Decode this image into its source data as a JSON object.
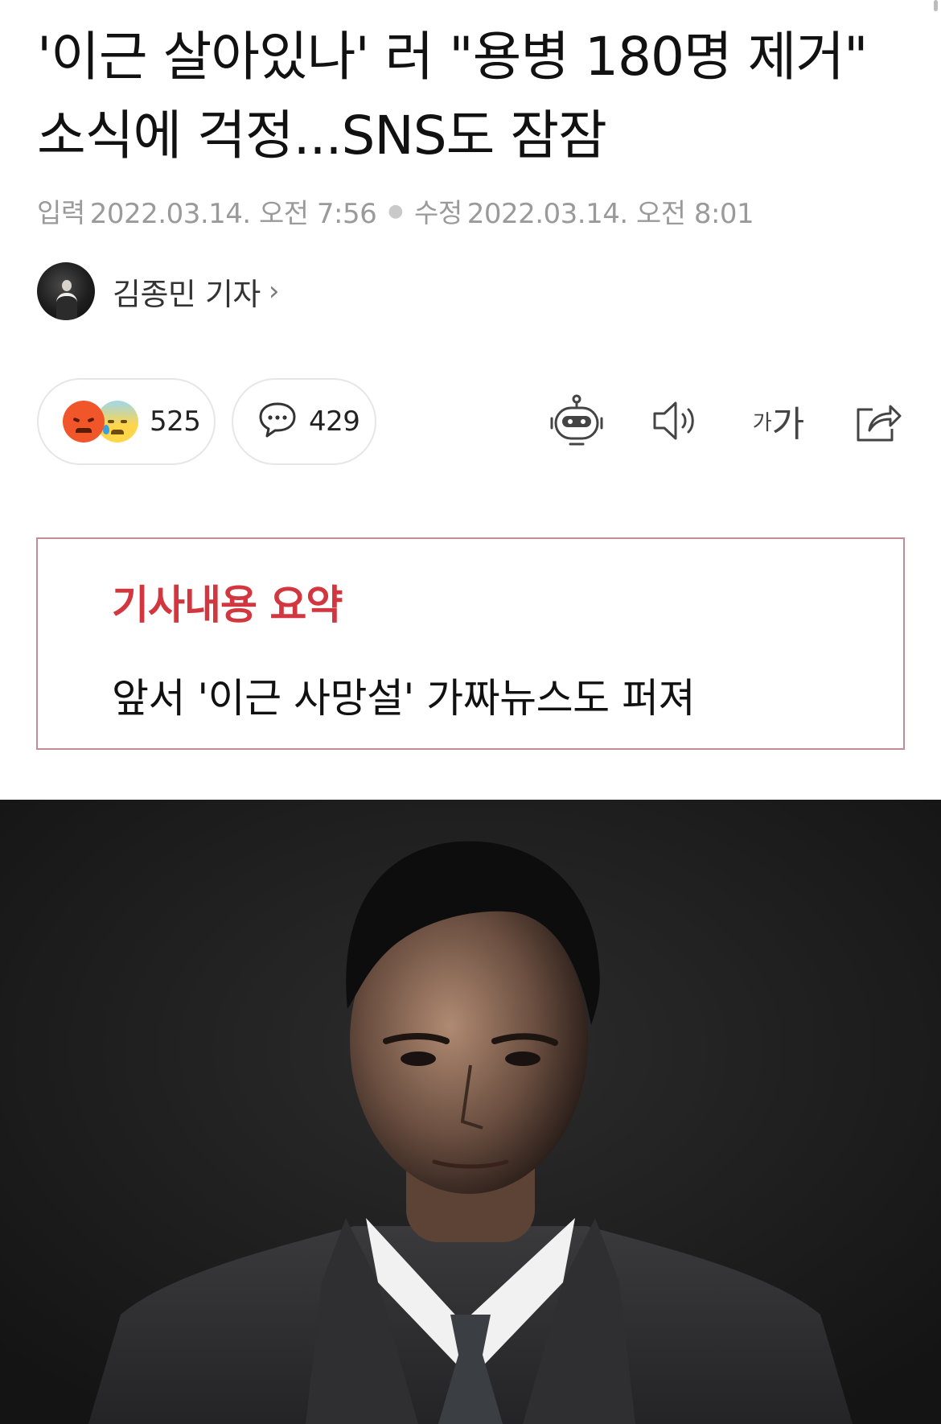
{
  "article": {
    "title": "'이근 살아있나' 러 \"용병 180명 제거\" 소식에 걱정...SNS도 잠잠",
    "input_label": "입력",
    "input_date": "2022.03.14. 오전 7:56",
    "modified_label": "수정",
    "modified_date": "2022.03.14. 오전 8:01",
    "author": "김종민 기자"
  },
  "reactions": {
    "count": "525",
    "emojis": [
      "angry-face",
      "sad-sweat-face"
    ]
  },
  "comments": {
    "count": "429"
  },
  "tools": [
    "robot-summary-icon",
    "speaker-icon",
    "font-size-icon",
    "share-icon"
  ],
  "font_size_icon": {
    "small": "가",
    "large": "가"
  },
  "summary": {
    "title": "기사내용 요약",
    "text": "앞서 '이근 사망설' 가짜뉴스도 퍼져"
  },
  "colors": {
    "summary_title": "#d2363f",
    "summary_border": "#c48b98",
    "photo_background": "#1c1c1c"
  }
}
